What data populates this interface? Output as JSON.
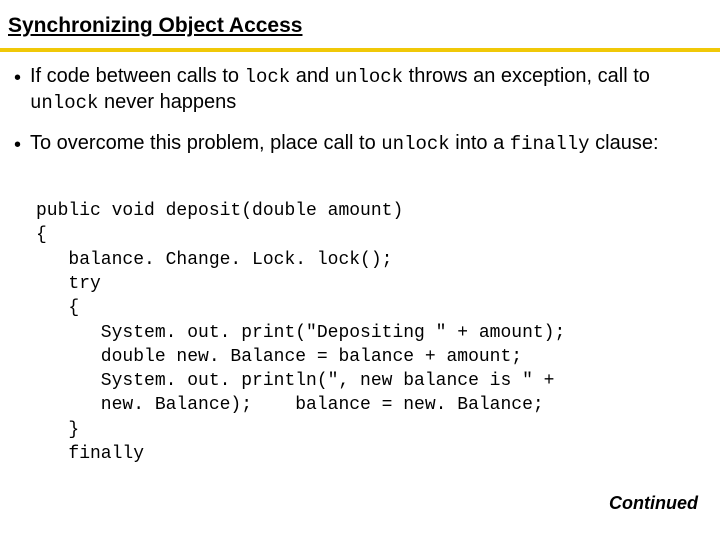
{
  "title": "Synchronizing Object Access",
  "bullets": [
    {
      "pre1": "If code between calls to ",
      "code1": "lock",
      "mid1": " and ",
      "code2": "unlock",
      "mid2": " throws an exception, call to ",
      "code3": "unlock",
      "post": " never happens"
    },
    {
      "pre1": "To overcome this problem, place call to ",
      "code1": "unlock",
      "mid1": " into a ",
      "code2": "finally",
      "post": " clause:"
    }
  ],
  "code_lines": [
    "public void deposit(double amount)",
    "{",
    "   balance. Change. Lock. lock();",
    "   try",
    "   {",
    "      System. out. print(\"Depositing \" + amount);",
    "      double new. Balance = balance + amount;",
    "      System. out. println(\", new balance is \" +",
    "      new. Balance);    balance = new. Balance;",
    "   }",
    "   finally"
  ],
  "continued": "Continued"
}
